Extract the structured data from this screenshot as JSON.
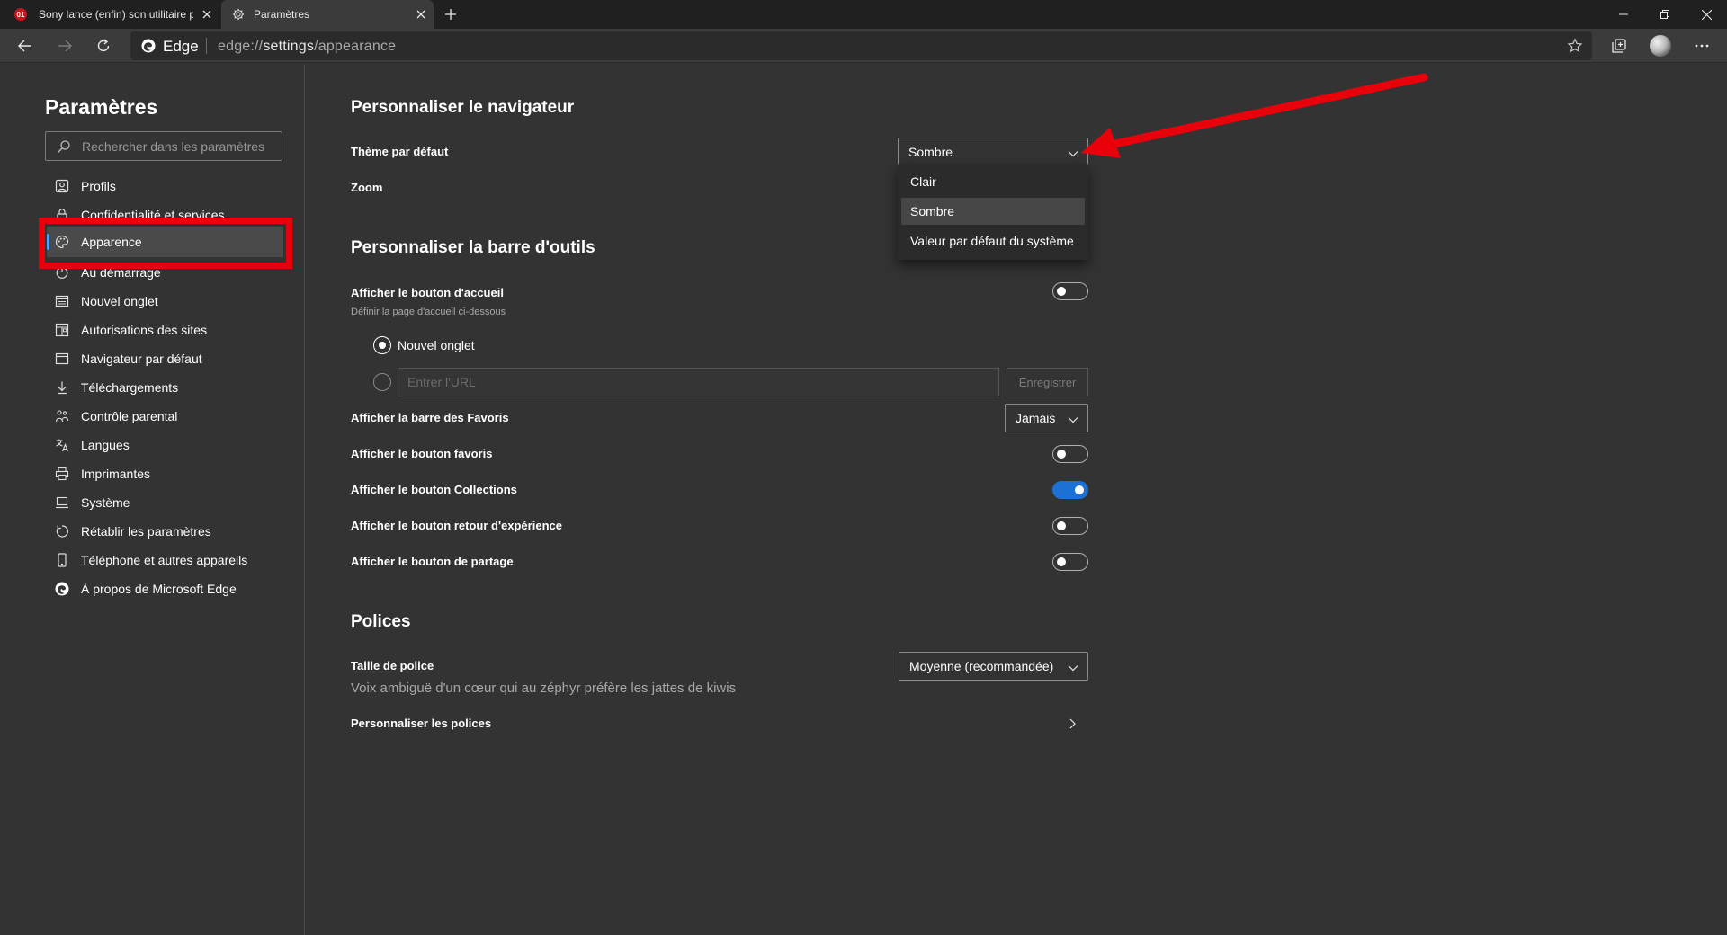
{
  "tabs": [
    {
      "title": "Sony lance (enfin) son utilitaire p",
      "favicon": "01-net-icon",
      "active": false
    },
    {
      "title": "Paramètres",
      "favicon": "gear-icon",
      "active": true
    }
  ],
  "address_bar": {
    "site_label": "Edge",
    "url_prefix": "edge://",
    "url_highlight": "settings",
    "url_suffix": "/appearance"
  },
  "sidebar": {
    "title": "Paramètres",
    "search_placeholder": "Rechercher dans les paramètres",
    "items": [
      {
        "label": "Profils",
        "icon": "profile-icon"
      },
      {
        "label": "Confidentialité et services",
        "icon": "lock-icon"
      },
      {
        "label": "Apparence",
        "icon": "palette-icon",
        "selected": true
      },
      {
        "label": "Au démarrage",
        "icon": "power-icon"
      },
      {
        "label": "Nouvel onglet",
        "icon": "new-tab-icon"
      },
      {
        "label": "Autorisations des sites",
        "icon": "site-permissions-icon"
      },
      {
        "label": "Navigateur par défaut",
        "icon": "browser-icon"
      },
      {
        "label": "Téléchargements",
        "icon": "download-icon"
      },
      {
        "label": "Contrôle parental",
        "icon": "family-icon"
      },
      {
        "label": "Langues",
        "icon": "language-icon"
      },
      {
        "label": "Imprimantes",
        "icon": "printer-icon"
      },
      {
        "label": "Système",
        "icon": "computer-icon"
      },
      {
        "label": "Rétablir les paramètres",
        "icon": "reset-icon"
      },
      {
        "label": "Téléphone et autres appareils",
        "icon": "phone-icon"
      },
      {
        "label": "À propos de Microsoft Edge",
        "icon": "edge-logo-icon"
      }
    ]
  },
  "main": {
    "customize_browser": {
      "title": "Personnaliser le navigateur",
      "theme_label": "Thème par défaut",
      "theme_value": "Sombre",
      "zoom_label": "Zoom",
      "theme_menu": [
        "Clair",
        "Sombre",
        "Valeur par défaut du système"
      ],
      "theme_menu_highlighted": "Sombre"
    },
    "customize_toolbar": {
      "title": "Personnaliser la barre d'outils",
      "home_button_label": "Afficher le bouton d'accueil",
      "home_button_on": false,
      "home_page_hint": "Définir la page d'accueil ci-dessous",
      "new_tab_option": "Nouvel onglet",
      "url_placeholder": "Entrer l'URL",
      "save_label": "Enregistrer",
      "favorites_bar_label": "Afficher la barre des Favoris",
      "favorites_bar_value": "Jamais",
      "favorites_button_label": "Afficher le bouton favoris",
      "favorites_button_on": false,
      "collections_button_label": "Afficher le bouton Collections",
      "collections_button_on": true,
      "feedback_button_label": "Afficher le bouton retour d'expérience",
      "feedback_button_on": false,
      "share_button_label": "Afficher le bouton de partage",
      "share_button_on": false
    },
    "fonts": {
      "title": "Polices",
      "font_size_label": "Taille de police",
      "font_size_value": "Moyenne (recommandée)",
      "preview_text": "Voix ambiguë d'un cœur qui au zéphyr préfère les jattes de kiwis",
      "customize_fonts_label": "Personnaliser les polices"
    }
  },
  "colors": {
    "accent": "#1d71d4",
    "annotation_red": "#e8000b",
    "background": "#333333"
  }
}
